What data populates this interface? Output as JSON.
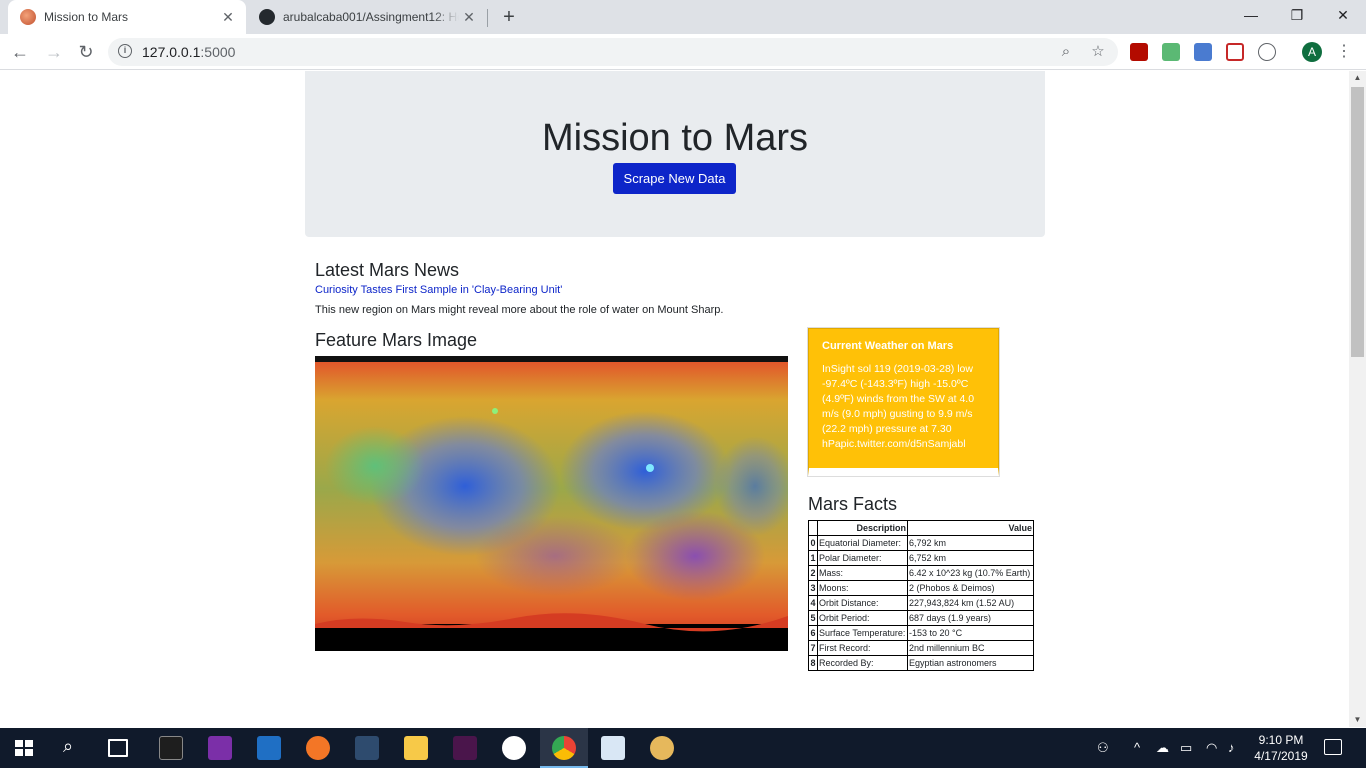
{
  "browser": {
    "tabs": [
      {
        "title": "Mission to Mars",
        "active": true
      },
      {
        "title": "arubalcaba001/Assingment12: Ho",
        "active": false
      }
    ],
    "url_host": "127.0.0.1",
    "url_port": ":5000",
    "avatar_letter": "A"
  },
  "page": {
    "title": "Mission to Mars",
    "scrape_button": "Scrape New Data",
    "news_heading": "Latest Mars News",
    "news_title": "Curiosity Tastes First Sample in 'Clay-Bearing Unit'",
    "news_paragraph": "This new region on Mars might reveal more about the role of water on Mount Sharp.",
    "featured_heading": "Feature Mars Image",
    "weather_heading": "Current Weather on Mars",
    "weather_text": "InSight sol 119 (2019-03-28) low -97.4ºC (-143.3ºF) high -15.0ºC (4.9ºF) winds from the SW at 4.0 m/s (9.0 mph) gusting to 9.9 m/s (22.2 mph) pressure at 7.30 hPapic.twitter.com/d5nSamjabl",
    "facts_heading": "Mars Facts",
    "facts_columns": [
      "Description",
      "Value"
    ],
    "facts_rows": [
      {
        "idx": "0",
        "desc": "Equatorial Diameter:",
        "value": "6,792 km"
      },
      {
        "idx": "1",
        "desc": "Polar Diameter:",
        "value": "6,752 km"
      },
      {
        "idx": "2",
        "desc": "Mass:",
        "value": "6.42 x 10^23 kg (10.7% Earth)"
      },
      {
        "idx": "3",
        "desc": "Moons:",
        "value": "2 (Phobos & Deimos)"
      },
      {
        "idx": "4",
        "desc": "Orbit Distance:",
        "value": "227,943,824 km (1.52 AU)"
      },
      {
        "idx": "5",
        "desc": "Orbit Period:",
        "value": "687 days (1.9 years)"
      },
      {
        "idx": "6",
        "desc": "Surface Temperature:",
        "value": "-153 to 20 °C"
      },
      {
        "idx": "7",
        "desc": "First Record:",
        "value": "2nd millennium BC"
      },
      {
        "idx": "8",
        "desc": "Recorded By:",
        "value": "Egyptian astronomers"
      }
    ]
  },
  "taskbar": {
    "time": "9:10 PM",
    "date": "4/17/2019"
  },
  "colors": {
    "primary_button": "#0d25c9",
    "weather_card": "#ffc107",
    "jumbotron": "#e9ecef"
  }
}
